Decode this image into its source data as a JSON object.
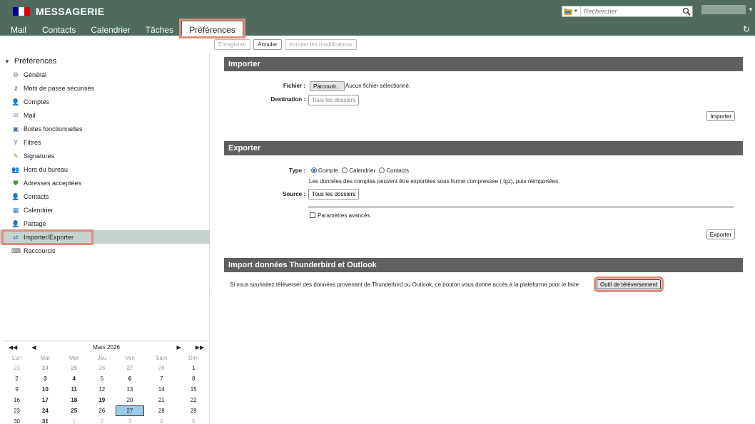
{
  "header": {
    "app_title": "MESSAGERIE",
    "flag_colors": [
      "#000091",
      "#ffffff",
      "#e1000f"
    ],
    "search": {
      "placeholder": "Rechercher",
      "scope_icon": "folder-icon"
    },
    "nav_tabs": [
      {
        "label": "Mail"
      },
      {
        "label": "Contacts"
      },
      {
        "label": "Calendrier"
      },
      {
        "label": "Tâches"
      },
      {
        "label": "Préférences",
        "active": true
      }
    ]
  },
  "toolbar": {
    "save_label": "Enregistrer",
    "cancel_label": "Annuler",
    "cancel_changes_label": "Annuler les modifications"
  },
  "sidebar": {
    "title": "Préférences",
    "items": [
      {
        "label": "Général",
        "icon": "gear-icon"
      },
      {
        "label": "Mots de passe sécurisés",
        "icon": "key-icon"
      },
      {
        "label": "Comptes",
        "icon": "user-icon"
      },
      {
        "label": "Mail",
        "icon": "envelope-icon"
      },
      {
        "label": "Boites fonctionnelles",
        "icon": "mailbox-icon"
      },
      {
        "label": "Filtres",
        "icon": "filter-icon"
      },
      {
        "label": "Signatures",
        "icon": "signature-icon"
      },
      {
        "label": "Hors du bureau",
        "icon": "away-icon"
      },
      {
        "label": "Adresses acceptées",
        "icon": "shield-check-icon"
      },
      {
        "label": "Contacts",
        "icon": "contact-icon"
      },
      {
        "label": "Calendrier",
        "icon": "calendar-icon"
      },
      {
        "label": "Partage",
        "icon": "share-icon"
      },
      {
        "label": "Importer/Exporter",
        "icon": "import-export-icon",
        "selected": true
      },
      {
        "label": "Raccourcis",
        "icon": "keyboard-icon"
      }
    ]
  },
  "calendar": {
    "month_label": "Mars 2026",
    "weekdays": [
      "Lun",
      "Mar",
      "Mer",
      "Jeu",
      "Ven",
      "Sam",
      "Dim"
    ],
    "weeks": [
      [
        "23",
        "24",
        "25",
        "26",
        "27",
        "28",
        "1"
      ],
      [
        "2",
        "3",
        "4",
        "5",
        "6",
        "7",
        "8"
      ],
      [
        "9",
        "10",
        "11",
        "12",
        "13",
        "14",
        "15"
      ],
      [
        "16",
        "17",
        "18",
        "19",
        "20",
        "21",
        "22"
      ],
      [
        "23",
        "24",
        "25",
        "26",
        "27",
        "28",
        "29"
      ],
      [
        "30",
        "31",
        "1",
        "2",
        "3",
        "4",
        "5"
      ]
    ],
    "today": "27"
  },
  "import": {
    "title": "Importer",
    "file_label": "Fichier :",
    "browse_label": "Parcourir...",
    "no_file_text": "Aucun fichier sélectionné.",
    "destination_label": "Destination :",
    "destination_value": "Tous les dossiers",
    "import_button": "Importer"
  },
  "export": {
    "title": "Exporter",
    "type_label": "Type :",
    "type_options": [
      "Compte",
      "Calendrier",
      "Contacts"
    ],
    "type_selected": "Compte",
    "hint": "Les données des comptes peuvent être exportées sous forme compressée (.tgz), puis réimportées.",
    "source_label": "Source :",
    "source_value": "Tous les dossiers",
    "advanced_label": "Paramètres avancés",
    "export_button": "Exporter"
  },
  "thunderbird": {
    "title": "Import données Thunderbird et Outlook",
    "description": "Si vous souhaitez téléverser des données provenant de Thunderbird ou Outlook, ce bouton vous donne accès à la plateforme pour le faire",
    "button": "Outil de téléversement"
  }
}
